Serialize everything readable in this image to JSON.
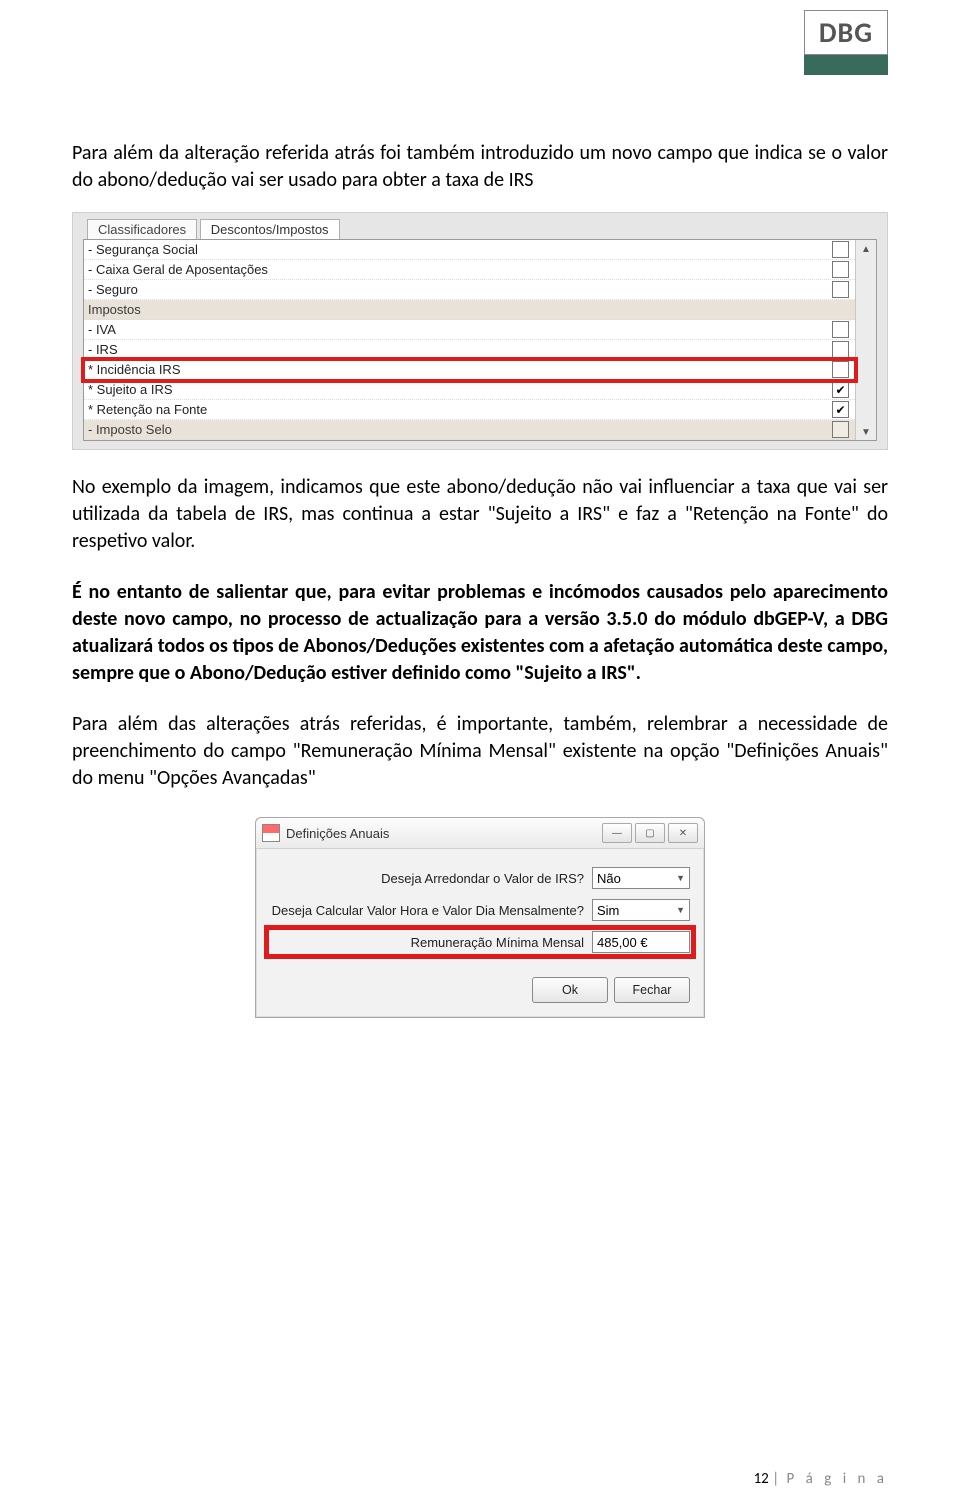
{
  "logo": "DBG",
  "para1": "Para além da alteração referida atrás foi também introduzido um novo campo que indica se o valor do abono/dedução vai ser usado para obter a taxa de IRS",
  "sh1": {
    "tab_classificadores": "Classificadores",
    "tab_descontos": "Descontos/Impostos",
    "rows": [
      {
        "label": "- Segurança Social",
        "type": "item",
        "checked": false
      },
      {
        "label": "- Caixa Geral de Aposentações",
        "type": "item",
        "checked": false
      },
      {
        "label": "- Seguro",
        "type": "item",
        "checked": false
      },
      {
        "label": "Impostos",
        "type": "group"
      },
      {
        "label": "- IVA",
        "type": "item",
        "checked": false
      },
      {
        "label": "- IRS",
        "type": "item",
        "checked": false
      },
      {
        "label": "* Incidência IRS",
        "type": "highlight",
        "checked": false
      },
      {
        "label": "* Sujeito a IRS",
        "type": "item",
        "checked": true
      },
      {
        "label": "* Retenção na Fonte",
        "type": "item",
        "checked": true
      },
      {
        "label": "- Imposto Selo",
        "type": "group2",
        "checked": false
      }
    ]
  },
  "para2": "No exemplo da imagem, indicamos que este abono/dedução não vai influenciar a taxa que vai ser utilizada da tabela de IRS, mas continua a estar \"Sujeito a IRS\" e faz a \"Retenção na Fonte\" do respetivo valor.",
  "para3": "É no entanto de salientar que, para evitar problemas e incómodos causados pelo aparecimento deste novo campo, no processo de actualização para a versão 3.5.0 do módulo dbGEP-V, a DBG atualizará todos os tipos de Abonos/Deduções existentes com a afetação automática deste campo, sempre que o Abono/Dedução estiver definido como \"Sujeito a IRS\".",
  "para4": "Para além das alterações atrás referidas, é importante, também, relembrar a necessidade de preenchimento do campo \"Remuneração Mínima Mensal\" existente na opção \"Definições Anuais\" do menu \"Opções Avançadas\"",
  "sh2": {
    "title": "Definições Anuais",
    "field1_label": "Deseja Arredondar o Valor de IRS?",
    "field1_value": "Não",
    "field2_label": "Deseja Calcular Valor Hora e Valor Dia Mensalmente?",
    "field2_value": "Sim",
    "field3_label": "Remuneração Mínima Mensal",
    "field3_value": "485,00 €",
    "btn_ok": "Ok",
    "btn_fechar": "Fechar"
  },
  "footer_num": "12",
  "footer_txt": "P á g i n a"
}
